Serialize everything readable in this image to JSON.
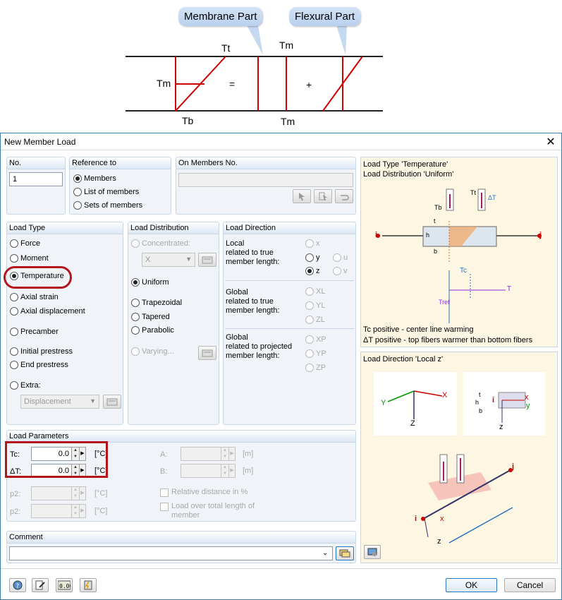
{
  "diagram": {
    "callout_membrane": "Membrane Part",
    "callout_flexural": "Flexural Part",
    "label_tt": "Tt",
    "label_tm_top": "Tm",
    "label_tm_left": "Tm",
    "label_tb": "Tb",
    "label_tm_bottom": "Tm",
    "equals": "=",
    "plus": "+"
  },
  "dialog": {
    "title": "New Member Load",
    "no": {
      "title": "No.",
      "value": "1"
    },
    "reference": {
      "title": "Reference to",
      "options": [
        {
          "label": "Members",
          "selected": true
        },
        {
          "label": "List of members",
          "selected": false
        },
        {
          "label": "Sets of members",
          "selected": false
        }
      ]
    },
    "on_members": {
      "title": "On Members No.",
      "value": ""
    },
    "load_type": {
      "title": "Load Type",
      "options": [
        {
          "label": "Force",
          "selected": false
        },
        {
          "label": "Moment",
          "selected": false
        },
        {
          "label": "Temperature",
          "selected": true
        },
        {
          "label": "Axial strain",
          "selected": false
        },
        {
          "label": "Axial displacement",
          "selected": false
        },
        {
          "label": "Precamber",
          "selected": false
        },
        {
          "label": "Initial prestress",
          "selected": false
        },
        {
          "label": "End prestress",
          "selected": false
        },
        {
          "label": "Extra:",
          "selected": false
        }
      ],
      "extra_value": "Displacement"
    },
    "load_distribution": {
      "title": "Load Distribution",
      "concentrated": "Concentrated:",
      "concentrated_value": "X",
      "options": [
        {
          "label": "Uniform",
          "selected": true
        },
        {
          "label": "Trapezoidal",
          "selected": false
        },
        {
          "label": "Tapered",
          "selected": false
        },
        {
          "label": "Parabolic",
          "selected": false
        }
      ],
      "varying": "Varying..."
    },
    "load_direction": {
      "title": "Load Direction",
      "local_text": "Local\nrelated to true\nmember length:",
      "local_opts": {
        "x": "x",
        "y": "y",
        "z": "z",
        "u": "u",
        "v": "v"
      },
      "global_true_text": "Global\nrelated to true\nmember length:",
      "global_true_opts": [
        "XL",
        "YL",
        "ZL"
      ],
      "global_proj_text": "Global\nrelated to projected\nmember length:",
      "global_proj_opts": [
        "XP",
        "YP",
        "ZP"
      ]
    },
    "load_parameters": {
      "title": "Load Parameters",
      "tc_label": "Tc:",
      "tc_value": "0.0",
      "tc_unit": "[°C]",
      "dt_label": "ΔT:",
      "dt_value": "0.0",
      "dt_unit": "[°C]",
      "p2a_label": "p2:",
      "p2a_unit": "[°C]",
      "p2b_label": "p2:",
      "p2b_unit": "[°C]",
      "a_label": "A:",
      "a_unit": "[m]",
      "b_label": "B:",
      "b_unit": "[m]",
      "relative_distance": "Relative distance in %",
      "load_over_total": "Load over total length of\nmember"
    },
    "comment": {
      "title": "Comment",
      "value": ""
    },
    "preview_top": {
      "line1": "Load Type 'Temperature'",
      "line2": "Load Distribution 'Uniform'",
      "caption1": "Tc positive - center line warming",
      "caption2": "ΔT positive - top fibers warmer than bottom fibers",
      "fig": {
        "i": "i",
        "j": "j",
        "tb": "Tb",
        "tt": "Tt",
        "dt": "ΔT",
        "t": "t",
        "h": "h",
        "b": "b",
        "tc": "Tc",
        "tref": "Tref",
        "T": "T"
      }
    },
    "preview_bottom": {
      "title": "Load Direction 'Local z'",
      "fig": {
        "x": "x",
        "y": "y",
        "z": "z",
        "Y": "Y",
        "X": "X",
        "Z": "Z",
        "i": "i",
        "j": "j",
        "t": "t",
        "h": "h",
        "b": "b"
      }
    },
    "buttons": {
      "ok": "OK",
      "cancel": "Cancel"
    }
  },
  "colors": {
    "accent_red": "#b3161d",
    "group_bg": "#f0f4f9",
    "preview_bg": "#fdf6e3"
  }
}
